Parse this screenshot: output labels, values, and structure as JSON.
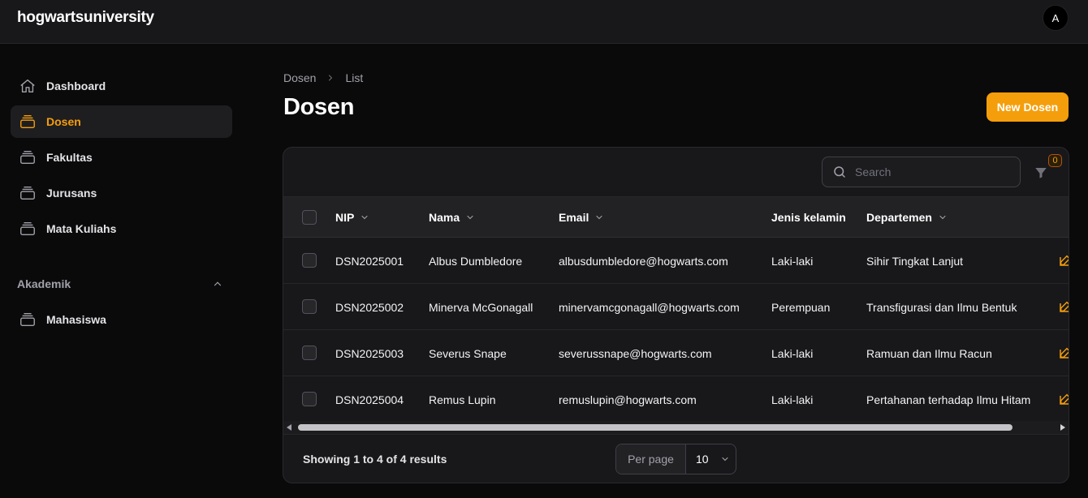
{
  "app": {
    "brand": "hogwartsuniversity",
    "avatar_initial": "A"
  },
  "sidebar": {
    "items": [
      {
        "label": "Dashboard",
        "icon": "home-icon",
        "active": false
      },
      {
        "label": "Dosen",
        "icon": "collection-icon",
        "active": true
      },
      {
        "label": "Fakultas",
        "icon": "collection-icon",
        "active": false
      },
      {
        "label": "Jurusans",
        "icon": "collection-icon",
        "active": false
      },
      {
        "label": "Mata Kuliahs",
        "icon": "collection-icon",
        "active": false
      }
    ],
    "group": {
      "label": "Akademik",
      "expanded": true,
      "items": [
        {
          "label": "Mahasiswa",
          "icon": "collection-icon"
        }
      ]
    }
  },
  "breadcrumb": {
    "items": [
      "Dosen",
      "List"
    ]
  },
  "page": {
    "title": "Dosen",
    "new_button": "New Dosen"
  },
  "table": {
    "search_placeholder": "Search",
    "filter_count": "0",
    "columns": [
      "NIP",
      "Nama",
      "Email",
      "Jenis kelamin",
      "Departemen"
    ],
    "rows": [
      {
        "nip": "DSN2025001",
        "nama": "Albus Dumbledore",
        "email": "albusdumbledore@hogwarts.com",
        "jenis_kelamin": "Laki-laki",
        "departemen": "Sihir Tingkat Lanjut"
      },
      {
        "nip": "DSN2025002",
        "nama": "Minerva McGonagall",
        "email": "minervamcgonagall@hogwarts.com",
        "jenis_kelamin": "Perempuan",
        "departemen": "Transfigurasi dan Ilmu Bentuk"
      },
      {
        "nip": "DSN2025003",
        "nama": "Severus Snape",
        "email": "severussnape@hogwarts.com",
        "jenis_kelamin": "Laki-laki",
        "departemen": "Ramuan dan Ilmu Racun"
      },
      {
        "nip": "DSN2025004",
        "nama": "Remus Lupin",
        "email": "remuslupin@hogwarts.com",
        "jenis_kelamin": "Laki-laki",
        "departemen": "Pertahanan terhadap Ilmu Hitam"
      }
    ],
    "showing": "Showing 1 to 4 of 4 results",
    "per_page_label": "Per page",
    "per_page_value": "10"
  },
  "colors": {
    "accent": "#f59e0b",
    "background": "#0a0a0b",
    "surface": "#18181b"
  }
}
